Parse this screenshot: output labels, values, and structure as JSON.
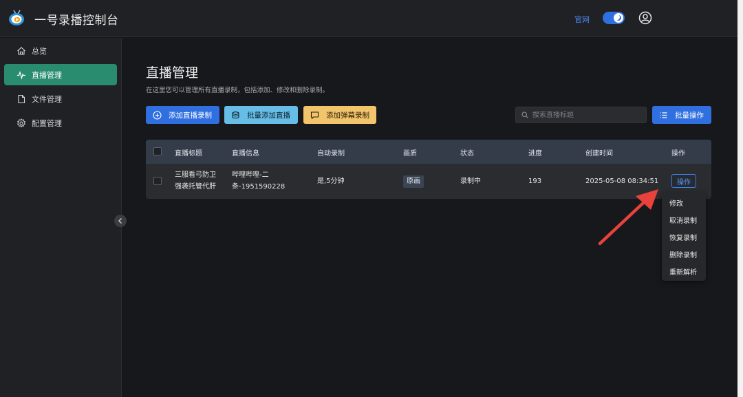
{
  "header": {
    "app_title": "一号录播控制台",
    "site_link": "官网"
  },
  "sidebar": {
    "items": [
      {
        "label": "总览"
      },
      {
        "label": "直播管理"
      },
      {
        "label": "文件管理"
      },
      {
        "label": "配置管理"
      }
    ]
  },
  "page": {
    "title": "直播管理",
    "description": "在这里您可以管理所有直播录制，包括添加、修改和删除录制。"
  },
  "toolbar": {
    "add_label": "添加直播录制",
    "batch_add_label": "批量添加直播",
    "danmu_label": "添加弹幕录制",
    "search_placeholder": "搜索直播标题",
    "bulk_label": "批量操作"
  },
  "table": {
    "headers": [
      "直播标题",
      "直播信息",
      "自动录制",
      "画质",
      "状态",
      "进度",
      "创建时间",
      "操作"
    ],
    "rows": [
      {
        "title_line1": "三服看弓防卫",
        "title_line2": "强袭托管代肝",
        "info_line1": "哔哩哔哩-二",
        "info_line2": "条-1951590228",
        "auto_record": "是,5分钟",
        "quality": "原画",
        "status": "录制中",
        "progress": "193",
        "created": "2025-05-08 08:34:51",
        "action": "操作"
      }
    ]
  },
  "dropdown": {
    "items": [
      "修改",
      "取消录制",
      "恢复录制",
      "删除录制",
      "重新解析"
    ]
  },
  "colors": {
    "accent": "#2f6fe0",
    "active_nav": "#2a8c6e",
    "arrow": "#e8423c"
  }
}
